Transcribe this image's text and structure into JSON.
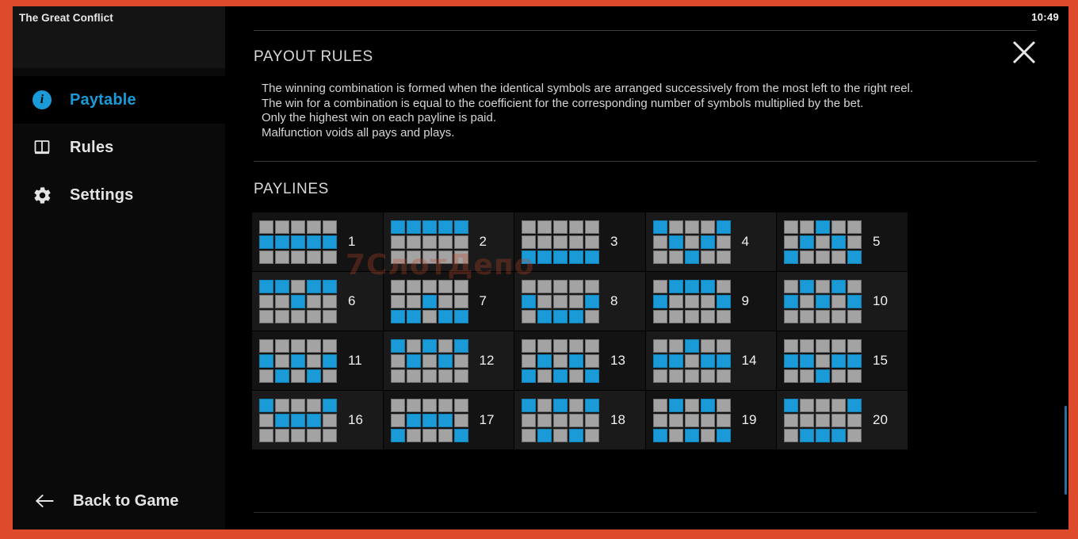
{
  "theme": {
    "bezel_color": "#dd4b2c",
    "stage_bg": "#000000",
    "sidebar_bg": "#0a0a0a",
    "accent_color": "#1a9ad6",
    "payline_on_color": "#1a9ad6",
    "payline_off_color": "#a3a3a3",
    "text_color": "#d8d8d8"
  },
  "statusbar": {
    "time": "10:49"
  },
  "sidebar": {
    "game_title": "The Great Conflict",
    "items": [
      {
        "label": "Paytable",
        "icon": "info-icon",
        "active": true
      },
      {
        "label": "Rules",
        "icon": "book-icon",
        "active": false
      },
      {
        "label": "Settings",
        "icon": "gear-icon",
        "active": false
      }
    ],
    "footer": {
      "label": "Back to Game",
      "icon": "arrow-left-icon"
    }
  },
  "main": {
    "close_label": "close-icon",
    "payout_rules": {
      "title": "PAYOUT RULES",
      "lines": [
        "The winning combination is formed when the identical symbols are arranged successively from the most left to the right reel.",
        "The win for a combination is equal to the coefficient for the corresponding number of symbols multiplied by the bet.",
        "Only the highest win on each payline is paid.",
        "Malfunction voids all pays and plays."
      ]
    },
    "paylines": {
      "title": "PAYLINES",
      "rows": 3,
      "reels": 5,
      "items": [
        {
          "number": "1",
          "pattern": [
            1,
            1,
            1,
            1,
            1
          ]
        },
        {
          "number": "2",
          "pattern": [
            0,
            0,
            0,
            0,
            0
          ]
        },
        {
          "number": "3",
          "pattern": [
            2,
            2,
            2,
            2,
            2
          ]
        },
        {
          "number": "4",
          "pattern": [
            0,
            1,
            2,
            1,
            0
          ]
        },
        {
          "number": "5",
          "pattern": [
            2,
            1,
            0,
            1,
            2
          ]
        },
        {
          "number": "6",
          "pattern": [
            0,
            0,
            1,
            0,
            0
          ]
        },
        {
          "number": "7",
          "pattern": [
            2,
            2,
            1,
            2,
            2
          ]
        },
        {
          "number": "8",
          "pattern": [
            1,
            2,
            2,
            2,
            1
          ]
        },
        {
          "number": "9",
          "pattern": [
            1,
            0,
            0,
            0,
            1
          ]
        },
        {
          "number": "10",
          "pattern": [
            1,
            0,
            1,
            0,
            1
          ]
        },
        {
          "number": "11",
          "pattern": [
            1,
            2,
            1,
            2,
            1
          ]
        },
        {
          "number": "12",
          "pattern": [
            0,
            1,
            0,
            1,
            0
          ]
        },
        {
          "number": "13",
          "pattern": [
            2,
            1,
            2,
            1,
            2
          ]
        },
        {
          "number": "14",
          "pattern": [
            1,
            1,
            0,
            1,
            1
          ]
        },
        {
          "number": "15",
          "pattern": [
            1,
            1,
            2,
            1,
            1
          ]
        },
        {
          "number": "16",
          "pattern": [
            0,
            1,
            1,
            1,
            0
          ]
        },
        {
          "number": "17",
          "pattern": [
            2,
            1,
            1,
            1,
            2
          ]
        },
        {
          "number": "18",
          "pattern": [
            0,
            2,
            0,
            2,
            0
          ]
        },
        {
          "number": "19",
          "pattern": [
            2,
            0,
            2,
            0,
            2
          ]
        },
        {
          "number": "20",
          "pattern": [
            0,
            2,
            2,
            2,
            0
          ]
        }
      ]
    }
  },
  "watermark": {
    "text": "7СлотДепо"
  }
}
